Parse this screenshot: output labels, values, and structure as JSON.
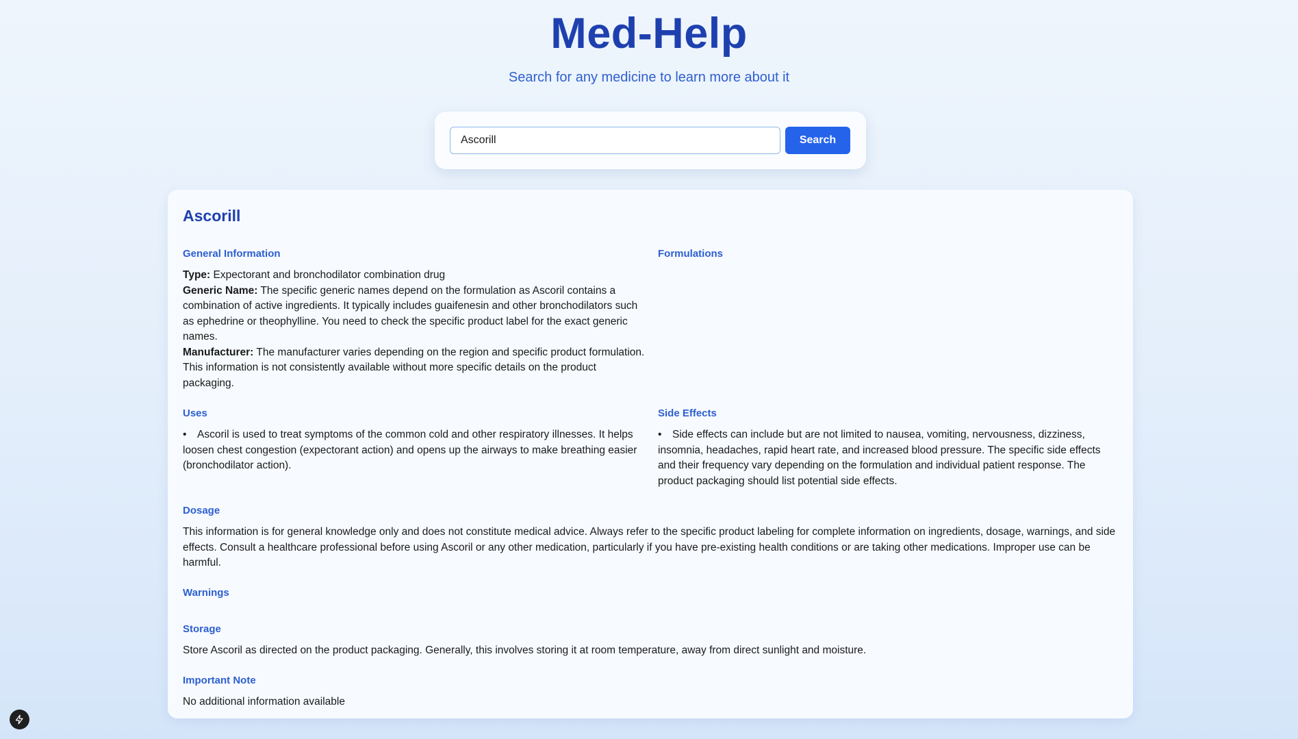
{
  "app": {
    "title": "Med-Help",
    "subtitle": "Search for any medicine to learn more about it"
  },
  "search": {
    "value": "Ascorill",
    "placeholder": "",
    "button_label": "Search"
  },
  "result": {
    "name": "Ascorill",
    "general_information": {
      "heading": "General Information",
      "type_label": "Type:",
      "type_value": "Expectorant and bronchodilator combination drug",
      "generic_label": "Generic Name:",
      "generic_value": "The specific generic names depend on the formulation as Ascoril contains a combination of active ingredients. It typically includes guaifenesin and other bronchodilators such as ephedrine or theophylline. You need to check the specific product label for the exact generic names.",
      "manufacturer_label": "Manufacturer:",
      "manufacturer_value": "The manufacturer varies depending on the region and specific product formulation. This information is not consistently available without more specific details on the product packaging."
    },
    "formulations": {
      "heading": "Formulations"
    },
    "uses": {
      "heading": "Uses",
      "items": [
        "Ascoril is used to treat symptoms of the common cold and other respiratory illnesses. It helps loosen chest congestion (expectorant action) and opens up the airways to make breathing easier (bronchodilator action)."
      ]
    },
    "side_effects": {
      "heading": "Side Effects",
      "items": [
        "Side effects can include but are not limited to nausea, vomiting, nervousness, dizziness, insomnia, headaches, rapid heart rate, and increased blood pressure. The specific side effects and their frequency vary depending on the formulation and individual patient response. The product packaging should list potential side effects."
      ]
    },
    "dosage": {
      "heading": "Dosage",
      "text": "This information is for general knowledge only and does not constitute medical advice. Always refer to the specific product labeling for complete information on ingredients, dosage, warnings, and side effects. Consult a healthcare professional before using Ascoril or any other medication, particularly if you have pre-existing health conditions or are taking other medications. Improper use can be harmful."
    },
    "warnings": {
      "heading": "Warnings"
    },
    "storage": {
      "heading": "Storage",
      "text": "Store Ascoril as directed on the product packaging. Generally, this involves storing it at room temperature, away from direct sunlight and moisture."
    },
    "important_note": {
      "heading": "Important Note",
      "text": "No additional information available"
    }
  },
  "icons": {
    "corner_badge": "lightning-bolt-icon"
  },
  "colors": {
    "brand": "#1e40af",
    "accent": "#2563eb",
    "section_heading": "#2c5fcf"
  }
}
